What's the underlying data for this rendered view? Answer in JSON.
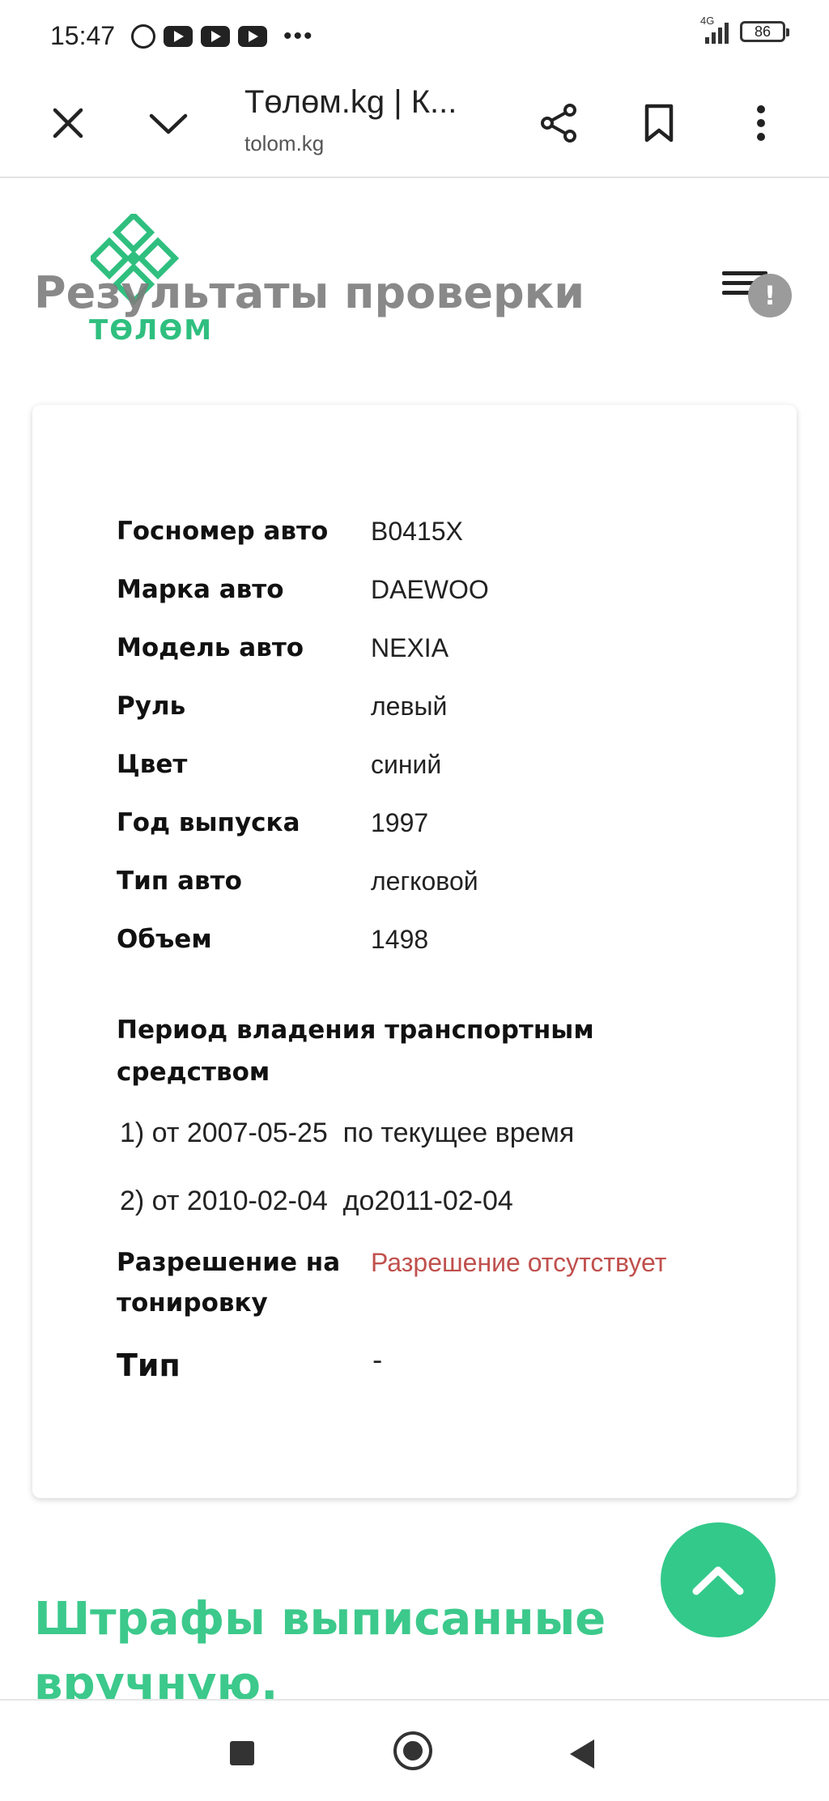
{
  "status_bar": {
    "time": "15:47",
    "network": "4G",
    "battery": "86"
  },
  "browser": {
    "title": "Төлөм.kg | К...",
    "url": "tolom.kg"
  },
  "header": {
    "logo_text": "ТӨЛӨМ",
    "page_title": "Результаты проверки",
    "alert_badge": "!"
  },
  "result": {
    "rows": [
      {
        "label": "Госномер авто",
        "value": "B0415X"
      },
      {
        "label": "Марка авто",
        "value": "DAEWOO"
      },
      {
        "label": "Модель авто",
        "value": "NEXIA"
      },
      {
        "label": "Руль",
        "value": "левый"
      },
      {
        "label": "Цвет",
        "value": "синий"
      },
      {
        "label": "Год выпуска",
        "value": "1997"
      },
      {
        "label": "Тип авто",
        "value": "легковой"
      },
      {
        "label": "Объем",
        "value": "1498"
      }
    ],
    "period_title": "Период владения транспортным средством",
    "periods": [
      "1) от 2007-05-25  по текущее время",
      "2) от 2010-02-04  до2011-02-04"
    ],
    "tint_label": "Разрешение на тонировку",
    "tint_value": "Разрешение отсутствует",
    "type_label": "Тип",
    "type_value": "-"
  },
  "fines": {
    "title": "Штрафы выписанные вручную."
  },
  "colors": {
    "brand_green": "#2fbf7f",
    "error_red": "#c0504d"
  }
}
